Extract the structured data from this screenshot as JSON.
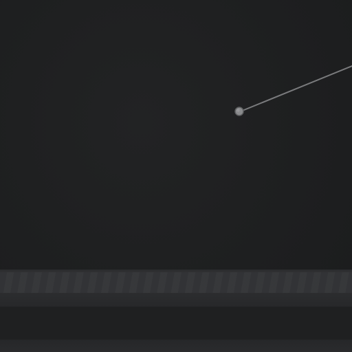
{
  "viewport": {
    "background": "#1e1f20"
  },
  "connector": {
    "icon": "handle-dot-icon",
    "line_color": "#7a7b7d",
    "handle_color": "#8a8b8d"
  },
  "strips": {
    "ribbon_color": "#36373a",
    "dark_color": "#1f2021"
  }
}
